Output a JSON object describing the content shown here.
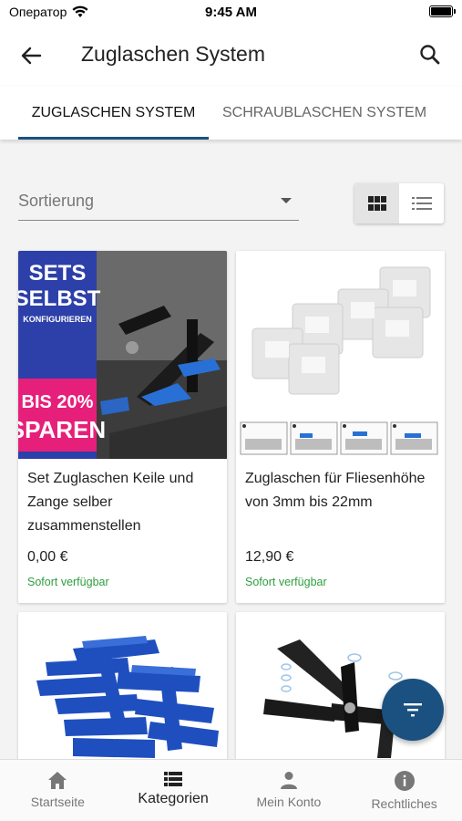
{
  "status_bar": {
    "carrier": "Оператор",
    "time": "9:45 AM"
  },
  "app_bar": {
    "title": "Zuglaschen System"
  },
  "tabs": [
    {
      "label": "ZUGLASCHEN SYSTEM",
      "active": true
    },
    {
      "label": "SCHRAUBLASCHEN SYSTEM",
      "active": false
    }
  ],
  "sort": {
    "label": "Sortierung"
  },
  "view_toggle": {
    "selected": "grid"
  },
  "products": [
    {
      "name": "Set Zuglaschen Keile und Zange selber zusammenstellen",
      "price": "0,00 €",
      "availability": "Sofort verfügbar",
      "image_text": {
        "line1": "SETS",
        "line2": "SELBST",
        "line3": "KONFIGURIEREN",
        "line4": "BIS 20%",
        "line5": "SPAREN"
      }
    },
    {
      "name": "Zuglaschen für Fliesenhöhe von 3mm bis 22mm",
      "price": "12,90 €",
      "availability": "Sofort verfügbar"
    }
  ],
  "bottom_nav": [
    {
      "label": "Startseite",
      "icon": "home-icon"
    },
    {
      "label": "Kategorien",
      "icon": "list-icon",
      "active": true
    },
    {
      "label": "Mein Konto",
      "icon": "person-icon"
    },
    {
      "label": "Rechtliches",
      "icon": "info-icon"
    }
  ],
  "colors": {
    "accent": "#1a5180",
    "availability": "#2e9e3e",
    "promo_blue": "#2d3fa8",
    "promo_pink": "#e6207a"
  }
}
